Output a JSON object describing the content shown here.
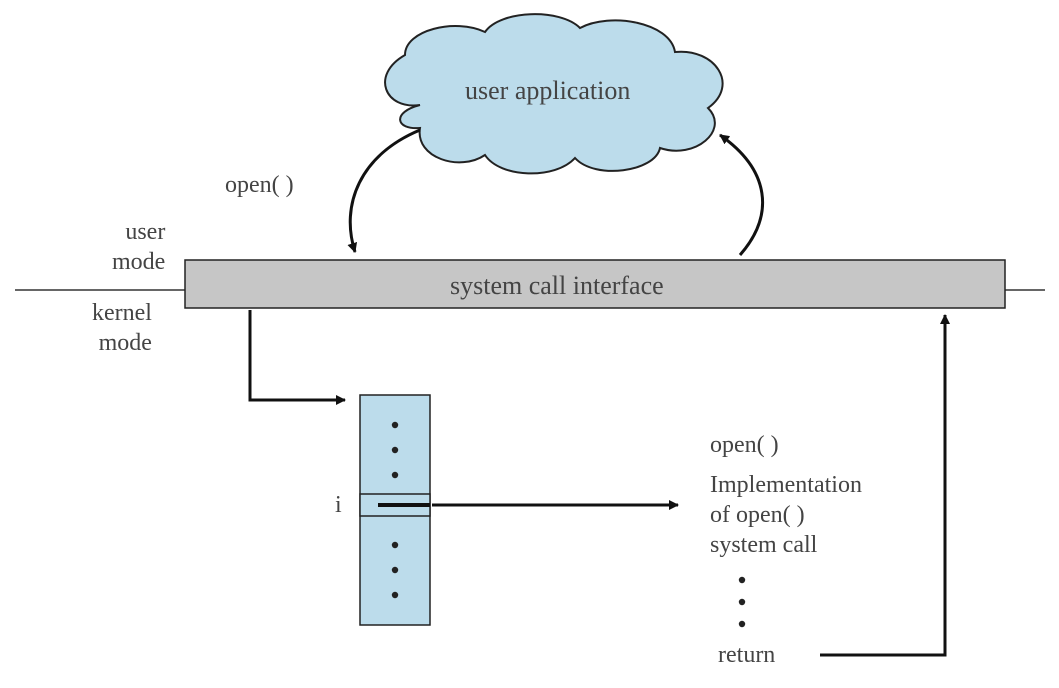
{
  "cloud": {
    "label": "user application"
  },
  "call_label": "open( )",
  "modes": {
    "user": "user",
    "kernel": "kernel",
    "mode_word": "mode"
  },
  "interface_bar": {
    "label": "system call interface"
  },
  "table_index_label": "i",
  "impl": {
    "header": "open( )",
    "line1": "Implementation",
    "line2": "of open( )",
    "line3": "system call",
    "return": "return"
  },
  "colors": {
    "cloud_fill": "#bcdceb",
    "cloud_stroke": "#222",
    "bar_fill": "#c6c6c6",
    "bar_stroke": "#222",
    "table_fill": "#bcdceb",
    "table_stroke": "#222",
    "arrow": "#111"
  }
}
